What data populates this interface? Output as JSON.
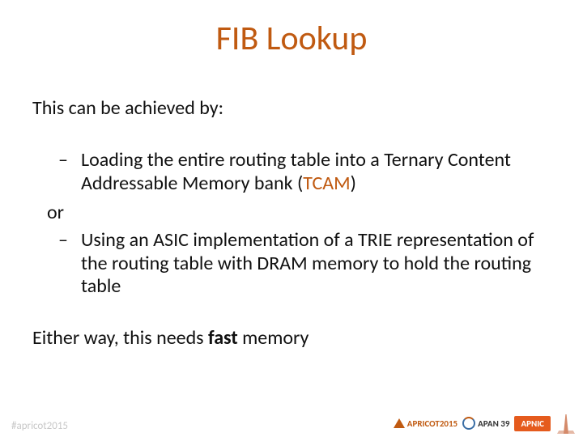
{
  "title": "FIB Lookup",
  "intro": "This can be achieved by:",
  "bullet1_pre": "Loading the entire routing table into a Ternary Content Addressable Memory bank (",
  "bullet1_acc": "TCAM",
  "bullet1_post": ")",
  "or_label": "or",
  "bullet2": "Using an ASIC implementation of a TRIE representation of the routing table with DRAM memory to hold the routing table",
  "conclusion_pre": "Either way, this needs ",
  "conclusion_bold": "fast",
  "conclusion_post": " memory",
  "footer": {
    "hashtag": "#apricot2015",
    "apricot": "APRICOT2015",
    "apan": "APAN 39",
    "apnic": "APNIC"
  }
}
